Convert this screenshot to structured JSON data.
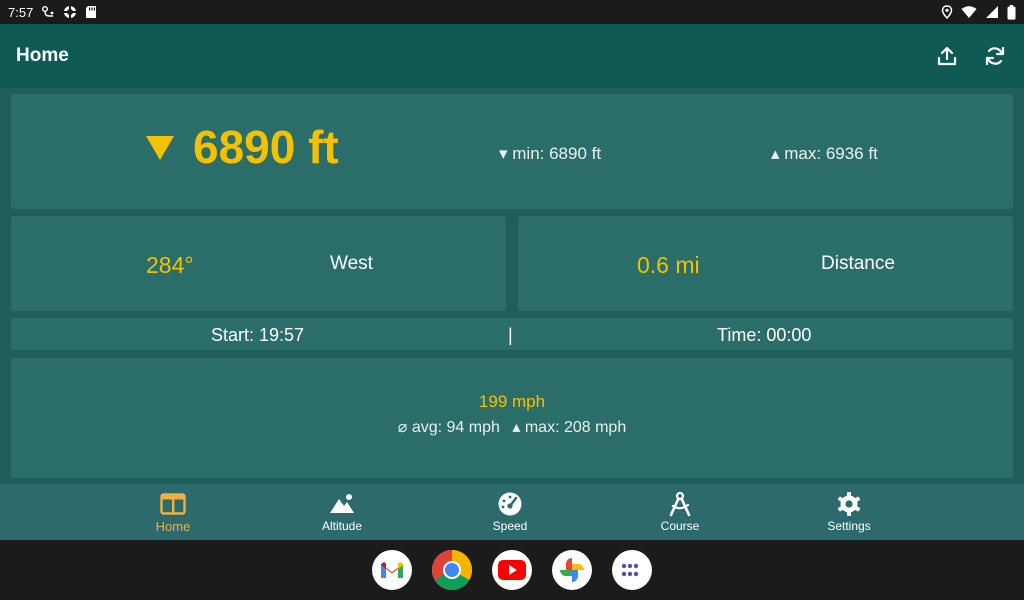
{
  "status_bar": {
    "time": "7:57",
    "left_icons": [
      "assistant-icon",
      "vpn-icon",
      "sd-card-icon"
    ],
    "right_icons": [
      "location-icon",
      "wifi-icon",
      "signal-icon",
      "battery-icon"
    ]
  },
  "app_bar": {
    "title": "Home",
    "actions": [
      "upload-icon",
      "refresh-icon"
    ]
  },
  "altitude": {
    "trend": "down",
    "value": "6890 ft",
    "min": "▾ min: 6890 ft",
    "max": "▴ max: 6936 ft"
  },
  "heading": {
    "value": "284°",
    "label": "West"
  },
  "distance": {
    "value": "0.6 mi",
    "label": "Distance"
  },
  "time_row": {
    "start": "Start: 19:57",
    "separator": "|",
    "elapsed": "Time: 00:00"
  },
  "speed": {
    "value": "199 mph",
    "avg": "⌀ avg: 94 mph",
    "max": "▴ max: 208 mph"
  },
  "bottom_nav": {
    "items": [
      {
        "label": "Home",
        "icon": "home-icon",
        "active": true
      },
      {
        "label": "Altitude",
        "icon": "landscape-icon",
        "active": false
      },
      {
        "label": "Speed",
        "icon": "speedometer-icon",
        "active": false
      },
      {
        "label": "Course",
        "icon": "compass-icon",
        "active": false
      },
      {
        "label": "Settings",
        "icon": "gear-icon",
        "active": false
      }
    ]
  },
  "dock": {
    "apps": [
      "gmail-icon",
      "chrome-icon",
      "youtube-icon",
      "photos-icon",
      "app-drawer-icon"
    ]
  },
  "colors": {
    "accent": "#f5c000",
    "nav_active": "#f0b040",
    "background": "#1e5f59",
    "card": "#2b6e69",
    "app_bar": "#0f5a54"
  }
}
